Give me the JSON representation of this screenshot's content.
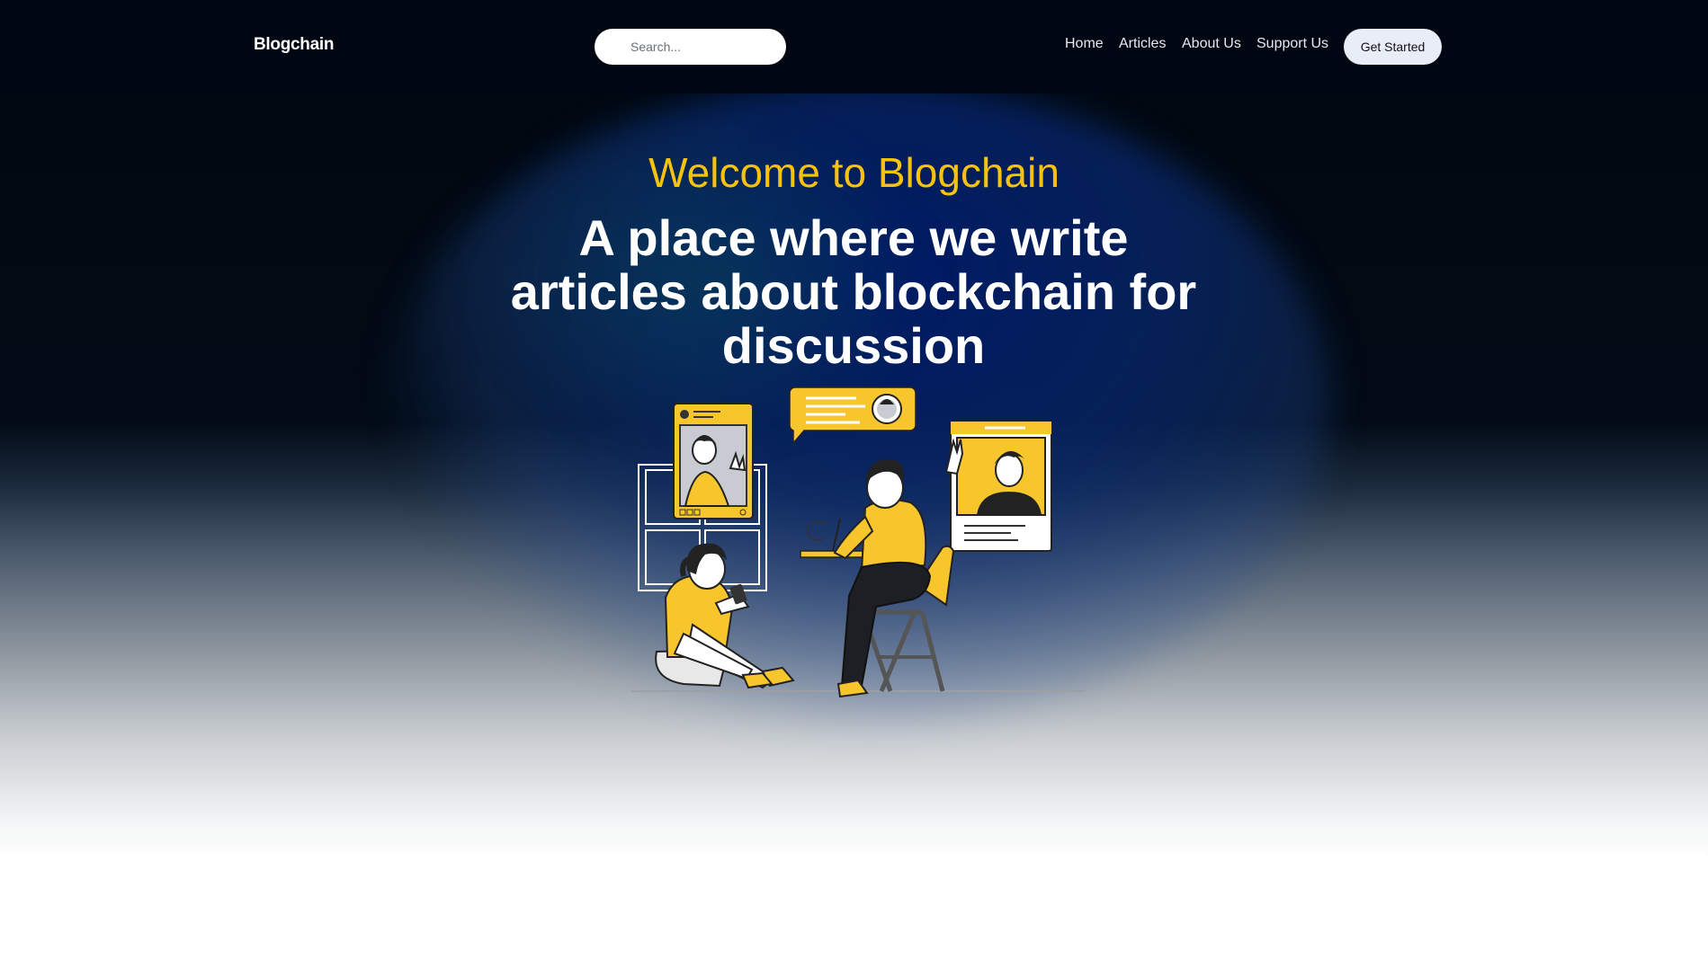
{
  "brand": {
    "name": "Blogchain"
  },
  "search": {
    "placeholder": "Search..."
  },
  "nav": {
    "items": [
      {
        "label": "Home"
      },
      {
        "label": "Articles"
      },
      {
        "label": "About Us"
      },
      {
        "label": "Support Us"
      }
    ],
    "cta_label": "Get Started"
  },
  "hero": {
    "welcome": "Welcome to Blogchain",
    "headline": "A place where we write articles about blockchain for discussion"
  },
  "colors": {
    "accent": "#f5c20d",
    "header_bg": "#010712",
    "glow": "#001c69"
  },
  "illustration": {
    "icon": "people-chatting-illustration"
  }
}
